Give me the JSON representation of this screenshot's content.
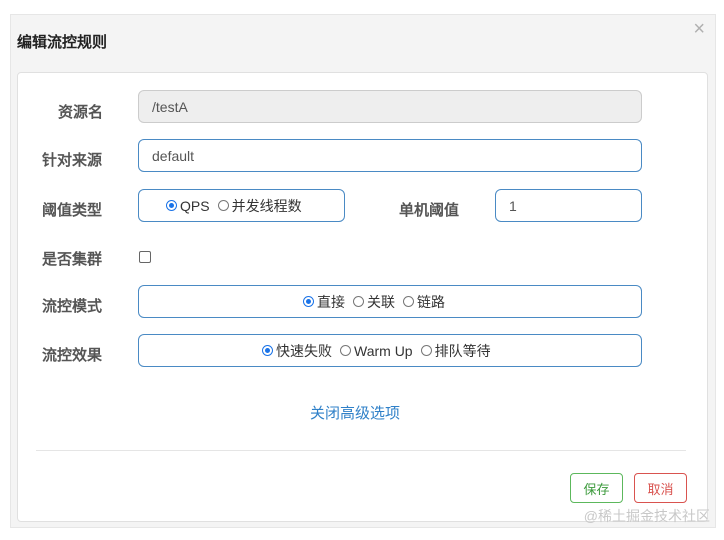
{
  "dialog": {
    "title": "编辑流控规则",
    "close_glyph": "×"
  },
  "form": {
    "resource_name": {
      "label": "资源名",
      "value": "/testA"
    },
    "limit_app": {
      "label": "针对来源",
      "value": "default"
    },
    "threshold_type": {
      "label": "阈值类型",
      "options": [
        "QPS",
        "并发线程数"
      ],
      "selected": "QPS"
    },
    "single_threshold": {
      "label": "单机阈值",
      "value": "1"
    },
    "cluster": {
      "label": "是否集群",
      "checked": false
    },
    "control_mode": {
      "label": "流控模式",
      "options": [
        "直接",
        "关联",
        "链路"
      ],
      "selected": "直接"
    },
    "control_effect": {
      "label": "流控效果",
      "options": [
        "快速失败",
        "Warm Up",
        "排队等待"
      ],
      "selected": "快速失败"
    }
  },
  "advanced_link": "关闭高级选项",
  "buttons": {
    "save": "保存",
    "cancel": "取消"
  },
  "watermark": "@稀土掘金技术社区"
}
